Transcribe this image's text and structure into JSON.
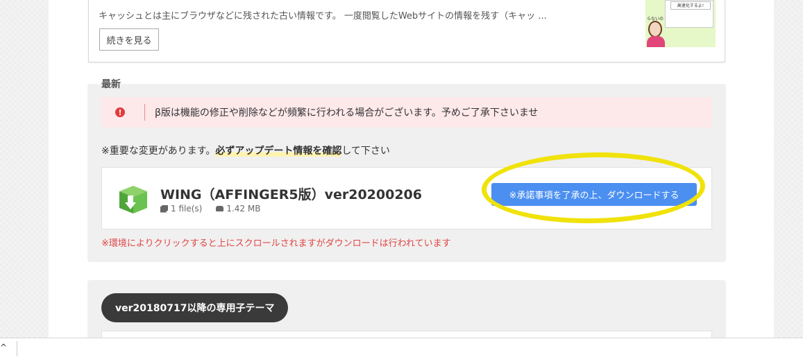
{
  "article": {
    "excerpt": "キャッシュとは主にブラウザなどに残された古い情報です。 一度閲覧したWebサイトの情報を残す（キャッ ...",
    "more_label": "続きを見る",
    "thumb_bubble": "高速化するよ!",
    "thumb_caption": "らないの"
  },
  "latest": {
    "section_label": "最新",
    "alert_icon": "!",
    "alert_text": "β版は機能の修正や削除などが頻繁に行われる場合がございます。予めご了承下さいませ",
    "notice_prefix": "※重要な変更があります。",
    "notice_strong": "必ずアップデート情報を確認",
    "notice_suffix": "して下さい",
    "file": {
      "title": "WING（AFFINGER5版）ver20200206",
      "files": "1 file(s)",
      "size": "1.42 MB",
      "icon": "package-icon"
    },
    "download_label": "※承諾事項を了承の上、ダウンロードする",
    "warning": "※環境によりクリックすると上にスクロールされますがダウンロードは行われています"
  },
  "child_theme": {
    "pill_label": "ver20180717以降の専用子テーマ"
  },
  "bottom_bar": {
    "chevron": "^"
  },
  "colors": {
    "download_button": "#4b8ff1",
    "highlight": "#f0e20a",
    "alert_bg": "#fde8ea",
    "warning_text": "#e04545"
  }
}
